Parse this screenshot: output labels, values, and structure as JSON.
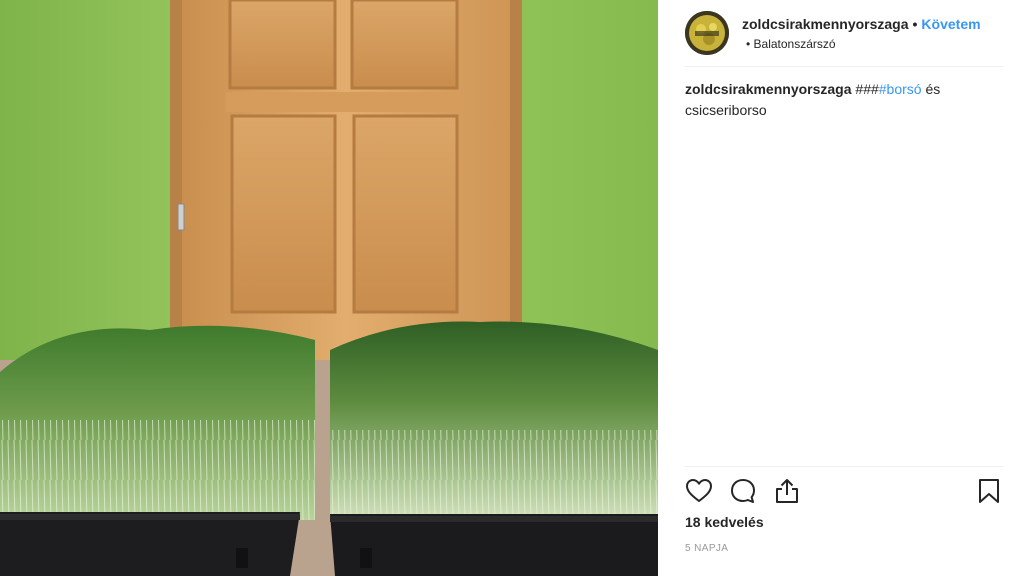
{
  "post": {
    "username": "zoldcsirakmennyorszaga",
    "separator": "•",
    "follow_label": "Követem",
    "location": "• Balatonszárszó",
    "caption": {
      "username": "zoldcsirakmennyorszaga",
      "hashes": "###",
      "hashtag": "#borsó",
      "rest": " és",
      "line2": "csicseriborso"
    },
    "likes": "18 kedvelés",
    "time": "5 NAPJA"
  },
  "icons": {
    "like": "heart-icon",
    "comment": "comment-bubble-icon",
    "share": "share-upload-icon",
    "save": "bookmark-icon"
  },
  "colors": {
    "link": "#3897f0",
    "wall": "#8cbf55",
    "door": "#d9a264"
  }
}
